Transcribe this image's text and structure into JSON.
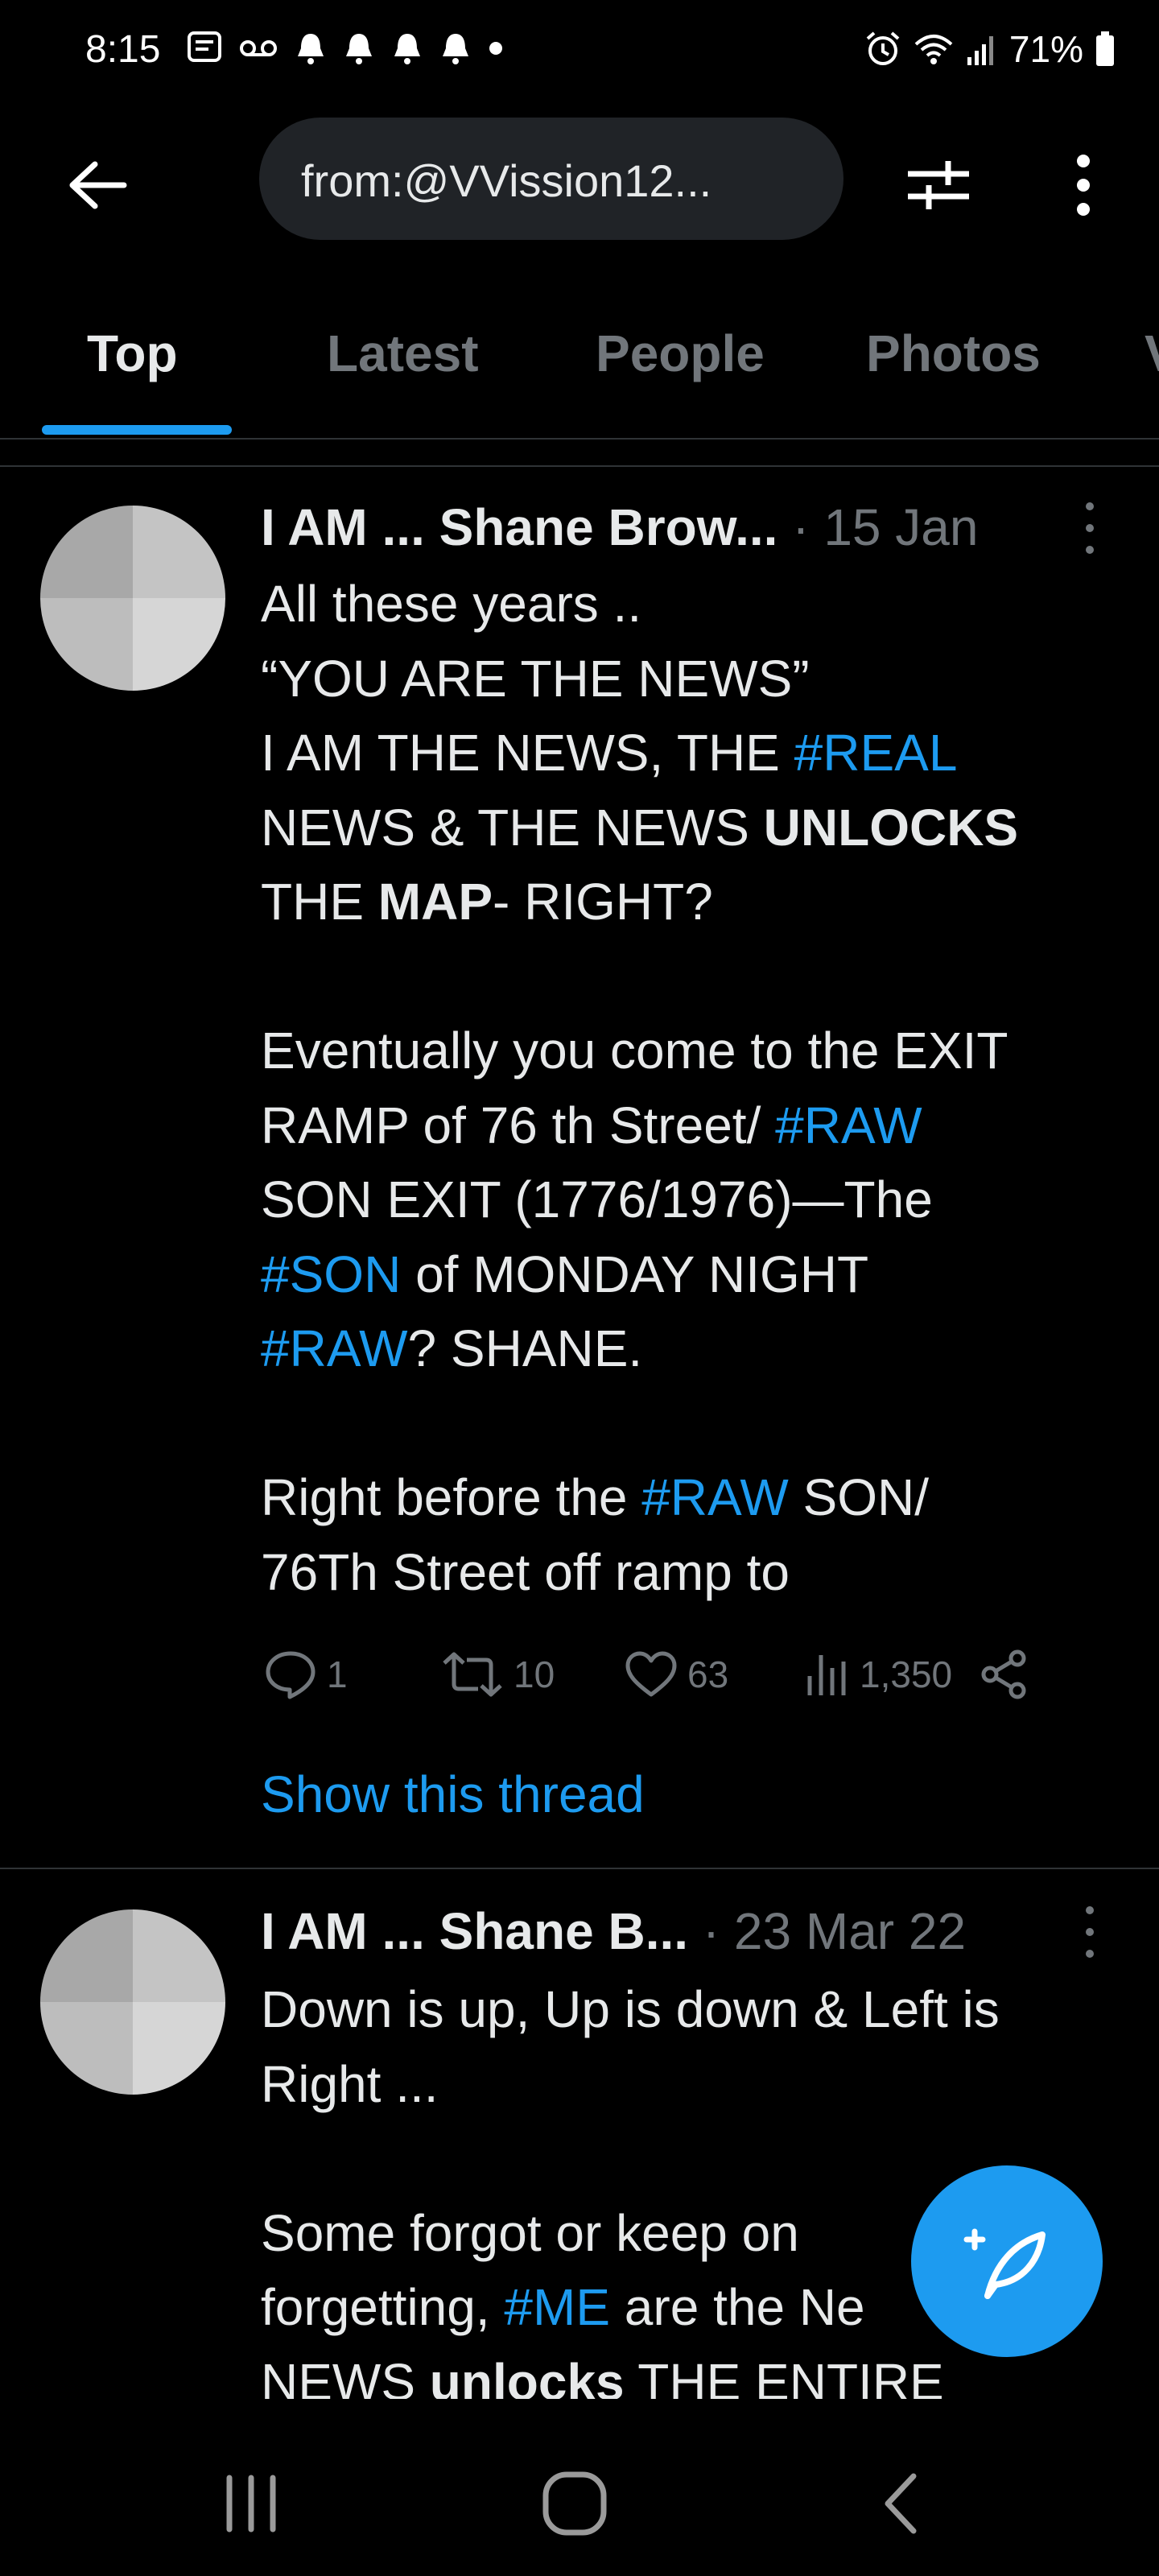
{
  "status_bar": {
    "time": "8:15",
    "battery": "71%"
  },
  "search": {
    "query": "from:@VVission12..."
  },
  "tabs": [
    {
      "label": "Top"
    },
    {
      "label": "Latest"
    },
    {
      "label": "People"
    },
    {
      "label": "Photos"
    },
    {
      "label": "V"
    }
  ],
  "tweets": [
    {
      "name": "I AM ... Shane Brow...",
      "date": "15 Jan",
      "replies": "1",
      "retweets": "10",
      "likes": "63",
      "views": "1,350",
      "show_thread": "Show this thread"
    },
    {
      "name": "I AM ... Shane B...",
      "date": "23 Mar 22"
    }
  ],
  "colors": {
    "accent": "#1d9bf0",
    "background": "#000000",
    "muted": "#71767b"
  }
}
